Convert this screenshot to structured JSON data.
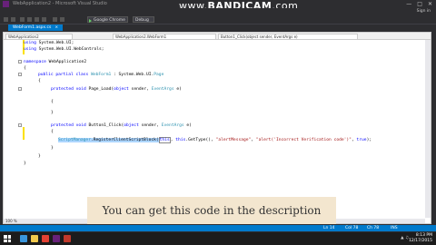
{
  "window": {
    "title": "WebApplication2 - Microsoft Visual Studio",
    "watermark_brand": "BANDICAM",
    "watermark_domain": ".com",
    "watermark_prefix": "www."
  },
  "menu": {
    "items": [
      "FILE",
      "EDIT",
      "VIEW",
      "PROJECT",
      "BUILD",
      "DEBUG",
      "TEAM",
      "TOOLS",
      "TEST",
      "ANALYZE",
      "WINDOW",
      "HELP"
    ],
    "signin": "Sign in"
  },
  "toolbar": {
    "run_label": "Google Chrome",
    "config_label": "Debug"
  },
  "tab": {
    "label": "WebForm1.aspx.cs"
  },
  "navbar": {
    "project": "WebApplication2",
    "class": "WebApplication2.WebForm1",
    "member": "Button1_Click(object sender, EventArgs e)"
  },
  "code": {
    "l1_kw": "using",
    "l1_rest": " System.Web.UI;",
    "l2_kw": "using",
    "l2_rest": " System.Web.UI.WebControls;",
    "l3_kw": "namespace",
    "l3_rest": " WebApplication2",
    "l4": "{",
    "l5_kw1": "public partial class",
    "l5_ty": " WebForm1",
    "l5_rest": " : System.Web.UI.",
    "l5_ty2": "Page",
    "l6": "{",
    "l7_kw": "protected void",
    "l7_rest": " Page_Load(",
    "l7_kw2": "object",
    "l7_rest2": " sender, ",
    "l7_ty": "EventArgs",
    "l7_rest3": " e)",
    "l8": "{",
    "l9": "}",
    "l10_kw": "protected void",
    "l10_rest": " Button1_Click(",
    "l10_kw2": "object",
    "l10_rest2": " sender, ",
    "l10_ty": "EventArgs",
    "l10_rest3": " e)",
    "l11": "{",
    "l12_ty": "ScriptManager",
    "l12_rest": ".RegisterClientScriptBlock(",
    "l12_kw": "this",
    "l12_rest2": ", ",
    "l12_kw2": "this",
    "l12_rest3": ".GetType(), ",
    "l12_str1": "\"alertMessage\"",
    "l12_rest4": ", ",
    "l12_str2": "\"alert('Incorrect Verification code')\"",
    "l12_rest5": ", ",
    "l12_kw3": "true",
    "l12_rest6": ");",
    "l13": "}",
    "l14": "}",
    "l15": "}"
  },
  "editor": {
    "zoom": "100 %"
  },
  "caption": {
    "text": "You can get this code in the description"
  },
  "status": {
    "ln": "Ln 14",
    "col": "Col 78",
    "ch": "Ch 78",
    "mode": "INS"
  },
  "clock": {
    "time": "8:13 PM",
    "date": "12/17/2015"
  },
  "colors": {
    "accent": "#007acc",
    "caption_bg": "#f3e6cf",
    "chrome": "#2d2d30"
  }
}
